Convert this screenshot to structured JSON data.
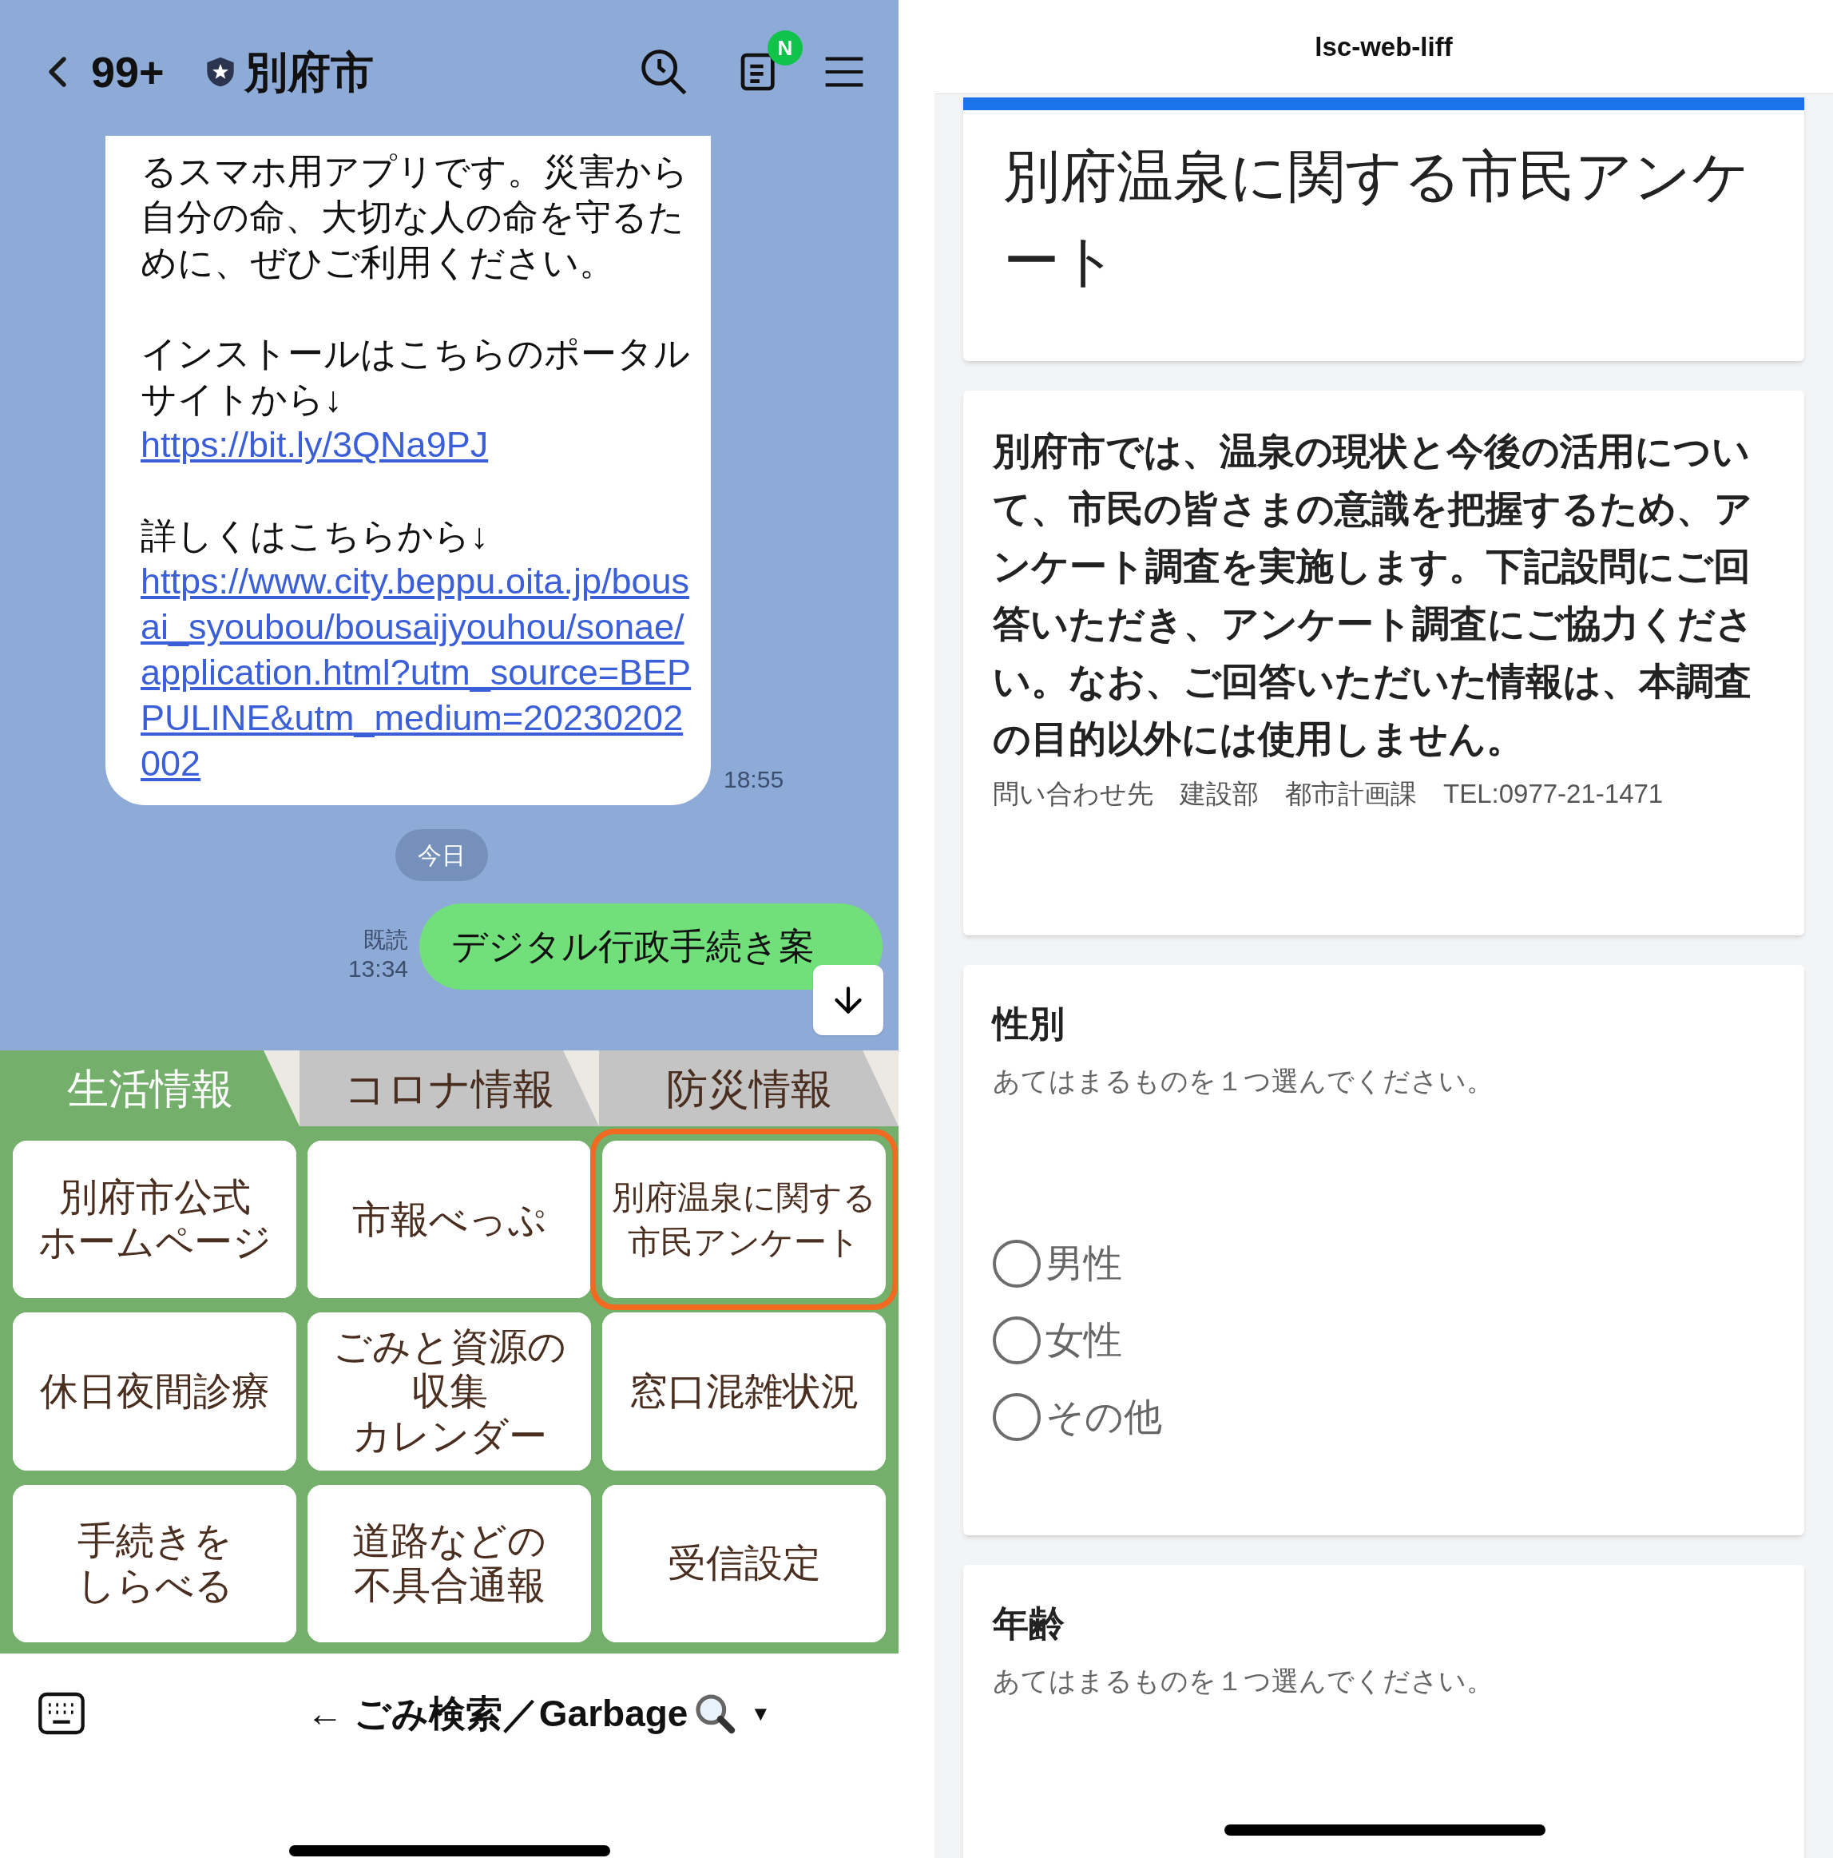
{
  "chat": {
    "back_count": "99+",
    "title": "別府市",
    "notes_badge": "N",
    "message": {
      "paragraphs": [
        {
          "kind": "text",
          "text": "るスマホ用アプリです。災害から自分の命、大切な人の命を守るために、ぜひご利用ください。"
        },
        {
          "kind": "text",
          "text": "インストールはこちらのポータルサイトから↓"
        },
        {
          "kind": "link",
          "text": "https://bit.ly/3QNa9PJ"
        },
        {
          "kind": "text",
          "text": "詳しくはこちらから↓"
        },
        {
          "kind": "link",
          "text": "https://www.city.beppu.oita.jp/bousai_syoubou/bousaijyouhou/sonae/application.html?utm_source=BEPPULINE&utm_medium=20230202002"
        }
      ],
      "time": "18:55"
    },
    "date_chip": "今日",
    "sent": {
      "read": "既読",
      "time": "13:34",
      "text": "デジタル行政手続き案"
    }
  },
  "rich_menu": {
    "tabs": [
      {
        "label": "生活情報",
        "selected": true
      },
      {
        "label": "コロナ情報",
        "selected": false
      },
      {
        "label": "防災情報",
        "selected": false
      }
    ],
    "items": [
      {
        "lines": [
          "別府市公式",
          "ホームページ"
        ],
        "highlighted": false
      },
      {
        "lines": [
          "市報べっぷ"
        ],
        "highlighted": false
      },
      {
        "lines": [
          "別府温泉に関する",
          "市民アンケート"
        ],
        "highlighted": true
      },
      {
        "lines": [
          "休日夜間診療"
        ],
        "highlighted": false
      },
      {
        "lines": [
          "ごみと資源の",
          "収集",
          "カレンダー"
        ],
        "highlighted": false
      },
      {
        "lines": [
          "窓口混雑状況"
        ],
        "highlighted": false
      },
      {
        "lines": [
          "手続きを",
          "しらべる"
        ],
        "highlighted": false
      },
      {
        "lines": [
          "道路などの",
          "不具合通報"
        ],
        "highlighted": false
      },
      {
        "lines": [
          "受信設定"
        ],
        "highlighted": false
      }
    ]
  },
  "bottom_bar": {
    "menu_label": "← ごみ検索／Garbage",
    "caret": "▼"
  },
  "form": {
    "window_title": "lsc-web-liff",
    "title": "別府温泉に関する市民アンケート",
    "description": "別府市では、温泉の現状と今後の活用について、市民の皆さまの意識を把握するため、アンケート調査を実施します。下記設問にご回答いただき、アンケート調査にご協力ください。なお、ご回答いただいた情報は、本調査の目的以外には使用しません。",
    "contact": "問い合わせ先　建設部　都市計画課　TEL:0977-21-1471",
    "questions": [
      {
        "title": "性別",
        "hint": "あてはまるものを１つ選んでください。",
        "options": [
          {
            "label": "男性",
            "selected": false
          },
          {
            "label": "女性",
            "selected": false
          },
          {
            "label": "その他",
            "selected": false
          }
        ]
      },
      {
        "title": "年齢",
        "hint": "あてはまるものを１つ選んでください。"
      }
    ]
  }
}
